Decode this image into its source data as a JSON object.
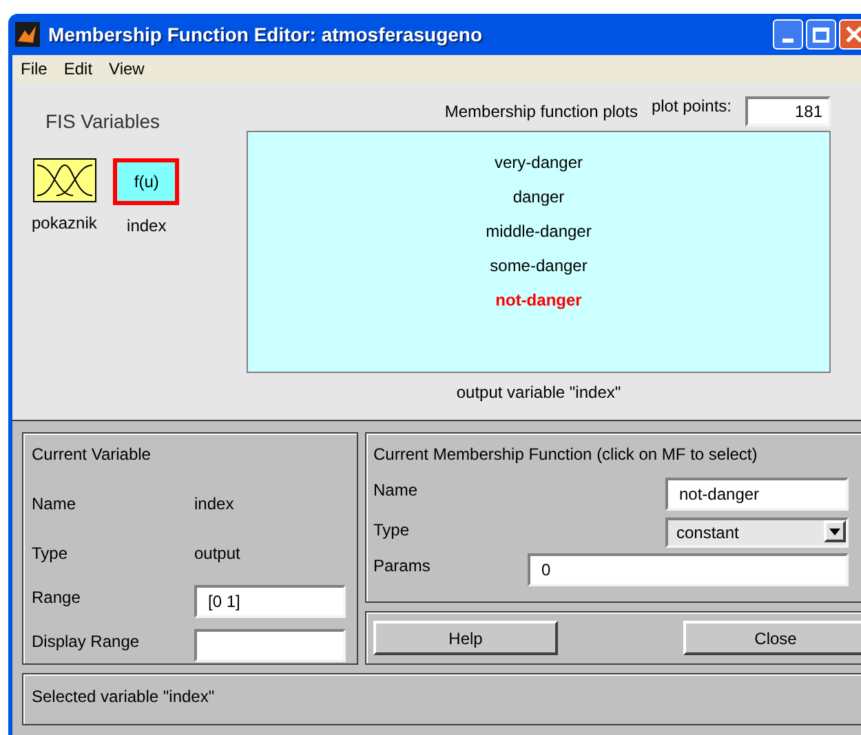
{
  "window": {
    "title": "Membership Function Editor: atmosferasugeno"
  },
  "menu": [
    "File",
    "Edit",
    "View"
  ],
  "fis_variables": {
    "title": "FIS Variables",
    "variables": [
      {
        "name": "pokaznik",
        "kind": "input",
        "selected": false
      },
      {
        "name": "index",
        "kind": "output",
        "label": "f(u)",
        "selected": true
      }
    ]
  },
  "plot": {
    "title": "Membership function plots",
    "plot_points_label": "plot points:",
    "plot_points": "181",
    "caption": "output variable \"index\"",
    "mfs": [
      {
        "label": "very-danger",
        "selected": false
      },
      {
        "label": "danger",
        "selected": false
      },
      {
        "label": "middle-danger",
        "selected": false
      },
      {
        "label": "some-danger",
        "selected": false
      },
      {
        "label": "not-danger",
        "selected": true
      }
    ]
  },
  "current_variable": {
    "title": "Current Variable",
    "name_label": "Name",
    "name": "index",
    "type_label": "Type",
    "type": "output",
    "range_label": "Range",
    "range": "[0 1]",
    "display_range_label": "Display Range"
  },
  "current_mf": {
    "title": "Current Membership Function (click on MF to select)",
    "name_label": "Name",
    "name": "not-danger",
    "type_label": "Type",
    "type": "constant",
    "params_label": "Params",
    "params": "0"
  },
  "buttons": [
    "Help",
    "Close"
  ],
  "status": "Selected variable \"index\""
}
